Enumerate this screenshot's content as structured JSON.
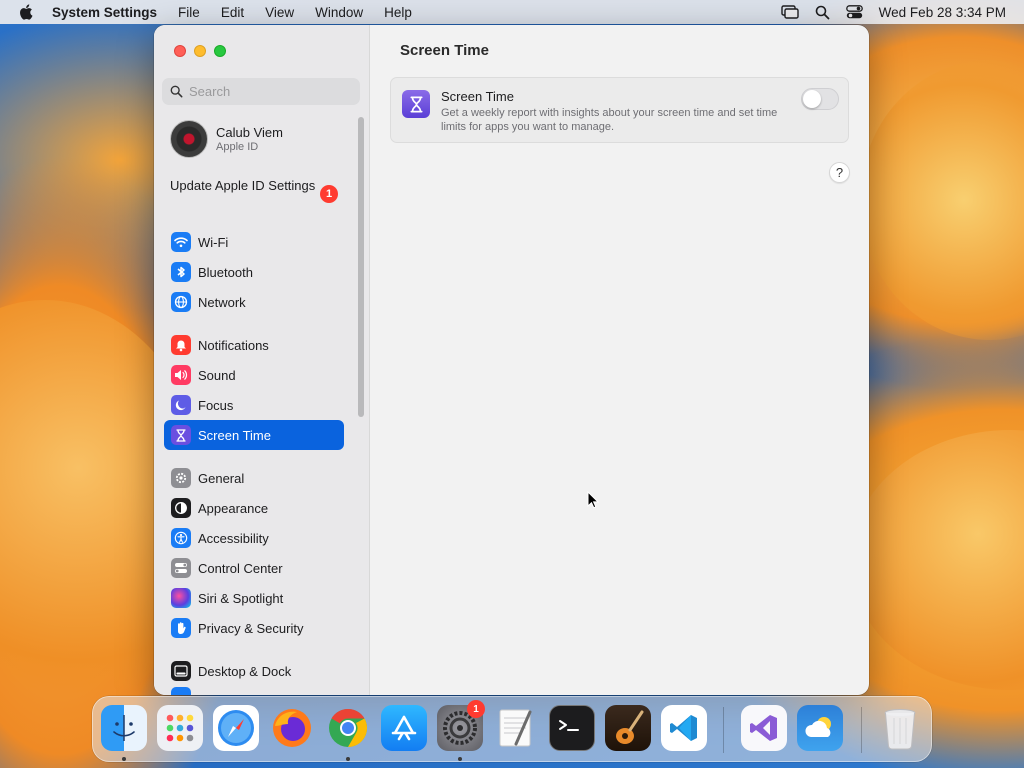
{
  "menubar": {
    "app_name": "System Settings",
    "menus": [
      "File",
      "Edit",
      "View",
      "Window",
      "Help"
    ],
    "clock": "Wed Feb 28  3:34 PM"
  },
  "sidebar": {
    "search_placeholder": "Search",
    "profile": {
      "name": "Calub Viem",
      "subtitle": "Apple ID"
    },
    "update": {
      "label": "Update Apple ID Settings",
      "badge": "1"
    },
    "items": [
      {
        "label": "Wi-Fi",
        "icon": "wifi-icon",
        "color": "#1a7cf5"
      },
      {
        "label": "Bluetooth",
        "icon": "bluetooth-icon",
        "color": "#1a7cf5"
      },
      {
        "label": "Network",
        "icon": "globe-icon",
        "color": "#1a7cf5"
      },
      {
        "label": "Notifications",
        "icon": "bell-icon",
        "color": "#ff3b30"
      },
      {
        "label": "Sound",
        "icon": "speaker-icon",
        "color": "#ff3b63"
      },
      {
        "label": "Focus",
        "icon": "moon-icon",
        "color": "#5e5ce6"
      },
      {
        "label": "Screen Time",
        "icon": "hourglass-icon",
        "color": "#6a4fe0",
        "selected": true
      },
      {
        "label": "General",
        "icon": "gear-icon",
        "color": "#8e8e93"
      },
      {
        "label": "Appearance",
        "icon": "appearance-icon",
        "color": "#1d1d1f"
      },
      {
        "label": "Accessibility",
        "icon": "accessibility-icon",
        "color": "#1a7cf5"
      },
      {
        "label": "Control Center",
        "icon": "toggles-icon",
        "color": "#8e8e93"
      },
      {
        "label": "Siri & Spotlight",
        "icon": "siri-icon",
        "color": "#2c2c2e"
      },
      {
        "label": "Privacy & Security",
        "icon": "hand-icon",
        "color": "#1a7cf5"
      },
      {
        "label": "Desktop & Dock",
        "icon": "dock-icon",
        "color": "#1d1d1f"
      }
    ]
  },
  "content": {
    "title": "Screen Time",
    "card": {
      "title": "Screen Time",
      "description": "Get a weekly report with insights about your screen time and set time limits for apps you want to manage.",
      "toggle_on": false
    },
    "help_label": "?"
  },
  "dock": {
    "apps": [
      {
        "name": "finder-icon",
        "running": true
      },
      {
        "name": "launchpad-icon",
        "running": false
      },
      {
        "name": "safari-icon",
        "running": false
      },
      {
        "name": "firefox-icon",
        "running": false
      },
      {
        "name": "chrome-icon",
        "running": true
      },
      {
        "name": "app-store-icon",
        "running": false
      },
      {
        "name": "system-settings-icon",
        "running": true,
        "badge": "1"
      },
      {
        "name": "textedit-icon",
        "running": false
      },
      {
        "name": "terminal-icon",
        "running": false
      },
      {
        "name": "garageband-icon",
        "running": false
      },
      {
        "name": "vscode-icon",
        "running": false
      },
      {
        "name": "visual-studio-icon",
        "running": false
      },
      {
        "name": "weather-icon",
        "running": false
      },
      {
        "name": "trash-icon",
        "running": false
      }
    ]
  }
}
